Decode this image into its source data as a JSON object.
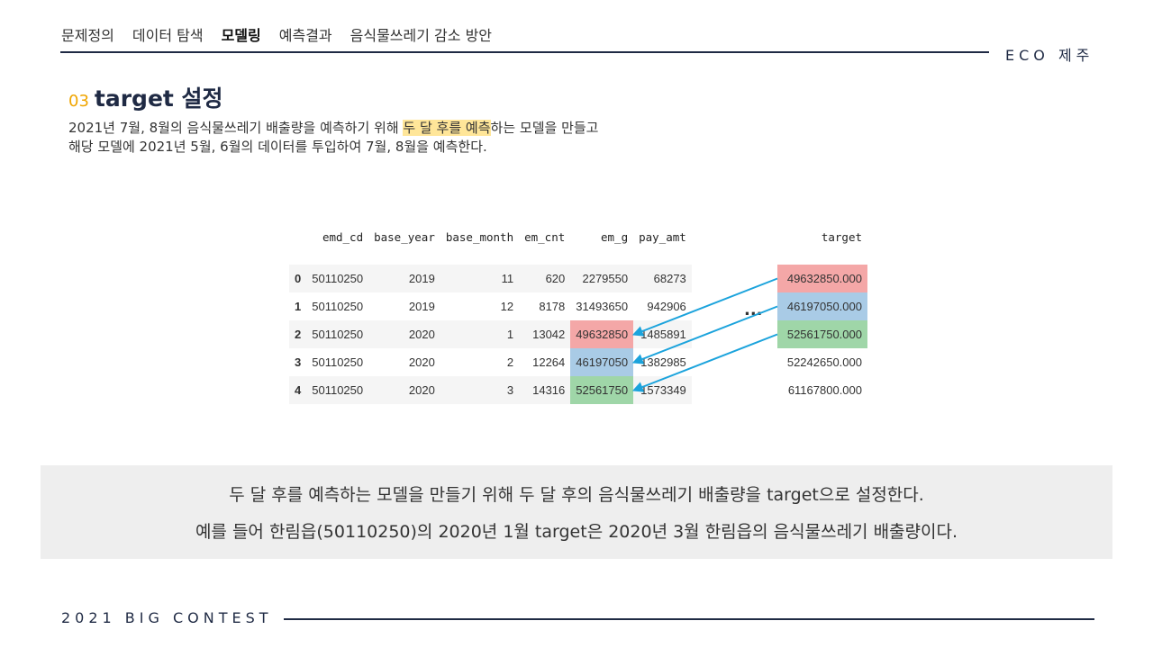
{
  "nav": {
    "items": [
      "문제정의",
      "데이터 탐색",
      "모델링",
      "예측결과",
      "음식물쓰레기 감소 방안"
    ],
    "active_index": 2
  },
  "brand": "ECO 제주",
  "section": {
    "number": "03",
    "title": "target 설정"
  },
  "description": {
    "line1_before": "2021년 7월, 8월의 음식물쓰레기 배출량을 예측하기 위해 ",
    "line1_highlight": "두 달 후를 예측",
    "line1_after": "하는 모델을 만들고",
    "line2": "해당 모델에 2021년 5월, 6월의 데이터를 투입하여 7월, 8월을 예측한다."
  },
  "dataframe": {
    "columns": [
      "",
      "emd_cd",
      "base_year",
      "base_month",
      "em_cnt",
      "em_g",
      "pay_amt"
    ],
    "rows": [
      [
        "0",
        "50110250",
        "2019",
        "11",
        "620",
        "2279550",
        "68273"
      ],
      [
        "1",
        "50110250",
        "2019",
        "12",
        "8178",
        "31493650",
        "942906"
      ],
      [
        "2",
        "50110250",
        "2020",
        "1",
        "13042",
        "49632850",
        "1485891"
      ],
      [
        "3",
        "50110250",
        "2020",
        "2",
        "12264",
        "46197050",
        "1382985"
      ],
      [
        "4",
        "50110250",
        "2020",
        "3",
        "14316",
        "52561750",
        "1573349"
      ]
    ]
  },
  "ellipsis": "...",
  "target_table": {
    "header": "target",
    "values": [
      "49632850.000",
      "46197050.000",
      "52561750.000",
      "52242650.000",
      "61167800.000"
    ]
  },
  "colors": {
    "red": "#f4a7a7",
    "blue": "#a9cbe6",
    "green": "#9fd6a8",
    "arrow": "#1ba3dc",
    "navy": "#1f2a44",
    "highlight": "#ffe699"
  },
  "summary": {
    "line1": "두 달 후를 예측하는 모델을 만들기 위해 두 달 후의 음식물쓰레기 배출량을 target으로 설정한다.",
    "line2": "예를 들어 한림읍(50110250)의 2020년 1월 target은 2020년 3월 한림읍의 음식물쓰레기 배출량이다."
  },
  "footer": "2021 BIG CONTEST"
}
